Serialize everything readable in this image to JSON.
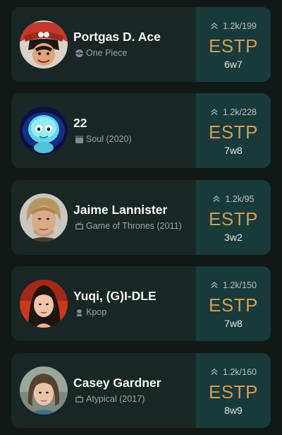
{
  "colors": {
    "background": "#111818",
    "card": "#182626",
    "card_accent": "#183a3a",
    "type_text": "#d19c57"
  },
  "profiles": [
    {
      "name": "Portgas D. Ace",
      "source": "One Piece",
      "source_icon": "anime-icon",
      "votes": "1.2k/199",
      "type": "ESTP",
      "wing": "6w7"
    },
    {
      "name": "22",
      "source": "Soul (2020)",
      "source_icon": "movie-icon",
      "votes": "1.2k/228",
      "type": "ESTP",
      "wing": "7w8"
    },
    {
      "name": "Jaime Lannister",
      "source": "Game of Thrones (2011)",
      "source_icon": "tv-icon",
      "votes": "1.2k/95",
      "type": "ESTP",
      "wing": "3w2"
    },
    {
      "name": "Yuqi, (G)I-DLE",
      "source": "Kpop",
      "source_icon": "kpop-icon",
      "votes": "1.2k/150",
      "type": "ESTP",
      "wing": "7w8"
    },
    {
      "name": "Casey Gardner",
      "source": "Atypical (2017)",
      "source_icon": "tv-icon",
      "votes": "1.2k/160",
      "type": "ESTP",
      "wing": "8w9"
    }
  ]
}
